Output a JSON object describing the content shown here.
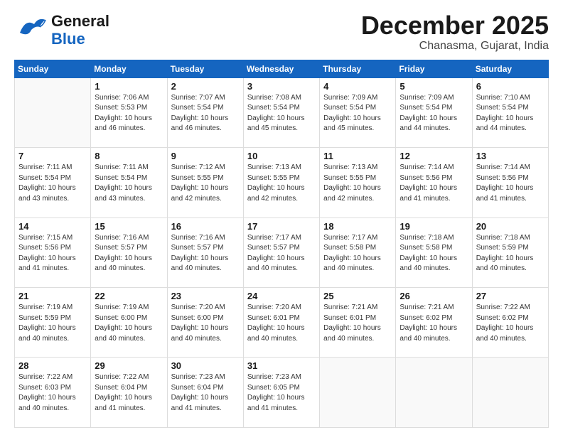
{
  "header": {
    "logo_line1": "General",
    "logo_line2": "Blue",
    "month": "December 2025",
    "location": "Chanasma, Gujarat, India"
  },
  "weekdays": [
    "Sunday",
    "Monday",
    "Tuesday",
    "Wednesday",
    "Thursday",
    "Friday",
    "Saturday"
  ],
  "weeks": [
    [
      {
        "day": "",
        "info": ""
      },
      {
        "day": "1",
        "info": "Sunrise: 7:06 AM\nSunset: 5:53 PM\nDaylight: 10 hours\nand 46 minutes."
      },
      {
        "day": "2",
        "info": "Sunrise: 7:07 AM\nSunset: 5:54 PM\nDaylight: 10 hours\nand 46 minutes."
      },
      {
        "day": "3",
        "info": "Sunrise: 7:08 AM\nSunset: 5:54 PM\nDaylight: 10 hours\nand 45 minutes."
      },
      {
        "day": "4",
        "info": "Sunrise: 7:09 AM\nSunset: 5:54 PM\nDaylight: 10 hours\nand 45 minutes."
      },
      {
        "day": "5",
        "info": "Sunrise: 7:09 AM\nSunset: 5:54 PM\nDaylight: 10 hours\nand 44 minutes."
      },
      {
        "day": "6",
        "info": "Sunrise: 7:10 AM\nSunset: 5:54 PM\nDaylight: 10 hours\nand 44 minutes."
      }
    ],
    [
      {
        "day": "7",
        "info": "Sunrise: 7:11 AM\nSunset: 5:54 PM\nDaylight: 10 hours\nand 43 minutes."
      },
      {
        "day": "8",
        "info": "Sunrise: 7:11 AM\nSunset: 5:54 PM\nDaylight: 10 hours\nand 43 minutes."
      },
      {
        "day": "9",
        "info": "Sunrise: 7:12 AM\nSunset: 5:55 PM\nDaylight: 10 hours\nand 42 minutes."
      },
      {
        "day": "10",
        "info": "Sunrise: 7:13 AM\nSunset: 5:55 PM\nDaylight: 10 hours\nand 42 minutes."
      },
      {
        "day": "11",
        "info": "Sunrise: 7:13 AM\nSunset: 5:55 PM\nDaylight: 10 hours\nand 42 minutes."
      },
      {
        "day": "12",
        "info": "Sunrise: 7:14 AM\nSunset: 5:56 PM\nDaylight: 10 hours\nand 41 minutes."
      },
      {
        "day": "13",
        "info": "Sunrise: 7:14 AM\nSunset: 5:56 PM\nDaylight: 10 hours\nand 41 minutes."
      }
    ],
    [
      {
        "day": "14",
        "info": "Sunrise: 7:15 AM\nSunset: 5:56 PM\nDaylight: 10 hours\nand 41 minutes."
      },
      {
        "day": "15",
        "info": "Sunrise: 7:16 AM\nSunset: 5:57 PM\nDaylight: 10 hours\nand 40 minutes."
      },
      {
        "day": "16",
        "info": "Sunrise: 7:16 AM\nSunset: 5:57 PM\nDaylight: 10 hours\nand 40 minutes."
      },
      {
        "day": "17",
        "info": "Sunrise: 7:17 AM\nSunset: 5:57 PM\nDaylight: 10 hours\nand 40 minutes."
      },
      {
        "day": "18",
        "info": "Sunrise: 7:17 AM\nSunset: 5:58 PM\nDaylight: 10 hours\nand 40 minutes."
      },
      {
        "day": "19",
        "info": "Sunrise: 7:18 AM\nSunset: 5:58 PM\nDaylight: 10 hours\nand 40 minutes."
      },
      {
        "day": "20",
        "info": "Sunrise: 7:18 AM\nSunset: 5:59 PM\nDaylight: 10 hours\nand 40 minutes."
      }
    ],
    [
      {
        "day": "21",
        "info": "Sunrise: 7:19 AM\nSunset: 5:59 PM\nDaylight: 10 hours\nand 40 minutes."
      },
      {
        "day": "22",
        "info": "Sunrise: 7:19 AM\nSunset: 6:00 PM\nDaylight: 10 hours\nand 40 minutes."
      },
      {
        "day": "23",
        "info": "Sunrise: 7:20 AM\nSunset: 6:00 PM\nDaylight: 10 hours\nand 40 minutes."
      },
      {
        "day": "24",
        "info": "Sunrise: 7:20 AM\nSunset: 6:01 PM\nDaylight: 10 hours\nand 40 minutes."
      },
      {
        "day": "25",
        "info": "Sunrise: 7:21 AM\nSunset: 6:01 PM\nDaylight: 10 hours\nand 40 minutes."
      },
      {
        "day": "26",
        "info": "Sunrise: 7:21 AM\nSunset: 6:02 PM\nDaylight: 10 hours\nand 40 minutes."
      },
      {
        "day": "27",
        "info": "Sunrise: 7:22 AM\nSunset: 6:02 PM\nDaylight: 10 hours\nand 40 minutes."
      }
    ],
    [
      {
        "day": "28",
        "info": "Sunrise: 7:22 AM\nSunset: 6:03 PM\nDaylight: 10 hours\nand 40 minutes."
      },
      {
        "day": "29",
        "info": "Sunrise: 7:22 AM\nSunset: 6:04 PM\nDaylight: 10 hours\nand 41 minutes."
      },
      {
        "day": "30",
        "info": "Sunrise: 7:23 AM\nSunset: 6:04 PM\nDaylight: 10 hours\nand 41 minutes."
      },
      {
        "day": "31",
        "info": "Sunrise: 7:23 AM\nSunset: 6:05 PM\nDaylight: 10 hours\nand 41 minutes."
      },
      {
        "day": "",
        "info": ""
      },
      {
        "day": "",
        "info": ""
      },
      {
        "day": "",
        "info": ""
      }
    ]
  ]
}
